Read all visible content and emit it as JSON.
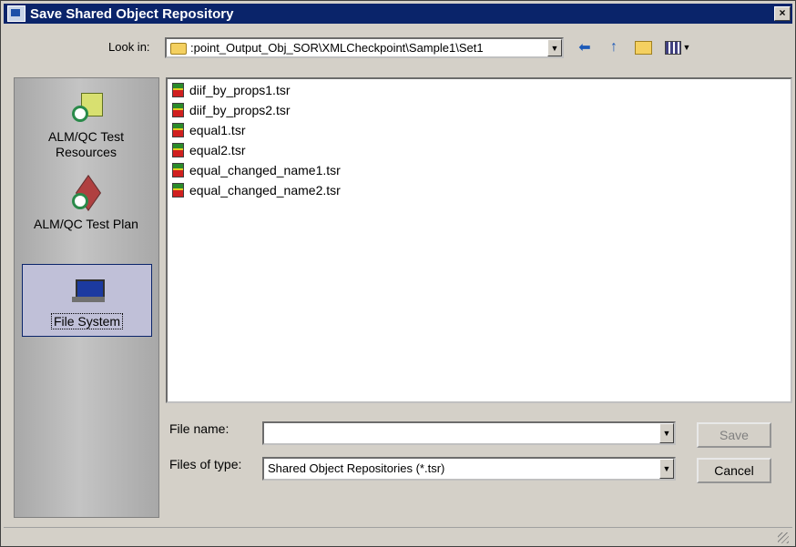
{
  "window": {
    "title": "Save Shared Object Repository",
    "close_label": "×"
  },
  "lookin": {
    "label": "Look in:",
    "path": ":point_Output_Obj_SOR\\XMLCheckpoint\\Sample1\\Set1",
    "icons": [
      "back-arrow-icon",
      "up-folder-icon",
      "new-folder-icon",
      "view-menu-icon"
    ]
  },
  "places": [
    {
      "label": "ALM/QC Test Resources",
      "icon": "test-resources-icon",
      "selected": false
    },
    {
      "label": "ALM/QC Test Plan",
      "icon": "test-plan-icon",
      "selected": false
    },
    {
      "label": "File System",
      "icon": "computer-icon",
      "selected": true
    }
  ],
  "files": [
    "diif_by_props1.tsr",
    "diif_by_props2.tsr",
    "equal1.tsr",
    "equal2.tsr",
    "equal_changed_name1.tsr",
    "equal_changed_name2.tsr"
  ],
  "form": {
    "filename_label": "File name:",
    "filename_value": "",
    "filetype_label": "Files of type:",
    "filetype_value": "Shared Object Repositories (*.tsr)"
  },
  "buttons": {
    "save": "Save",
    "cancel": "Cancel"
  }
}
